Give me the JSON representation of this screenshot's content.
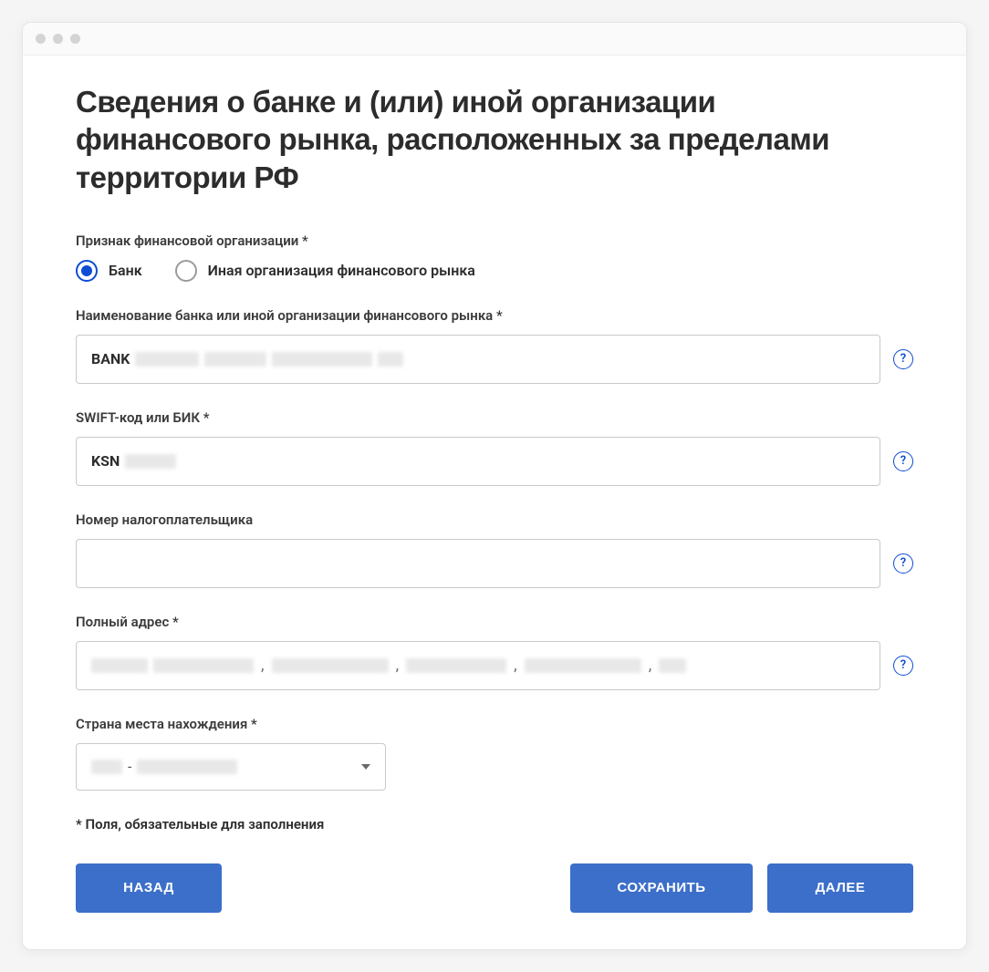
{
  "title": "Сведения о банке и (или) иной организации финансового рынка, расположенных  за пределами территории РФ",
  "fields": {
    "org_type": {
      "label": "Признак финансовой организации *",
      "options": {
        "bank": "Банк",
        "other": "Иная организация финансового рынка"
      },
      "selected": "bank"
    },
    "bank_name": {
      "label": "Наименование банка или иной организации финансового рынка *",
      "value_prefix": "BANK"
    },
    "swift": {
      "label": "SWIFT-код или БИК *",
      "value_prefix": "KSN"
    },
    "taxpayer": {
      "label": "Номер налогоплательщика",
      "value": ""
    },
    "address": {
      "label": "Полный адрес *"
    },
    "country": {
      "label": "Страна места нахождения *",
      "separator": "-"
    }
  },
  "footnote": "* Поля, обязательные для заполнения",
  "buttons": {
    "back": "НАЗАД",
    "save": "СОХРАНИТЬ",
    "next": "ДАЛЕЕ"
  }
}
